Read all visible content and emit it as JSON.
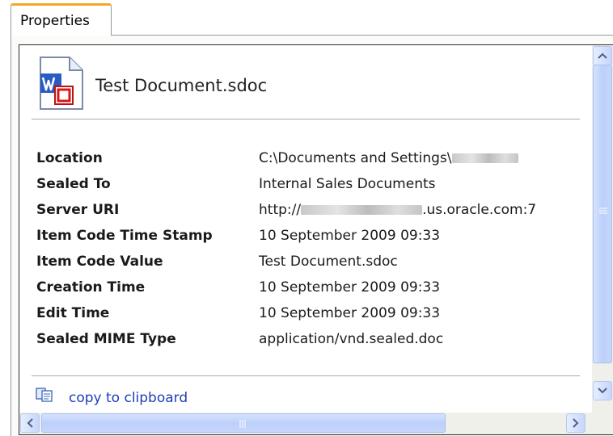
{
  "tab": {
    "label": "Properties"
  },
  "document": {
    "title": "Test Document.sdoc",
    "icon": "sealed-word-document-icon"
  },
  "properties": [
    {
      "label": "Location",
      "value": "C:\\Documents and Settings\\"
    },
    {
      "label": "Sealed To",
      "value": "Internal Sales Documents"
    },
    {
      "label": "Server URI",
      "value_prefix": "http://",
      "value_suffix": ".us.oracle.com:7"
    },
    {
      "label": "Item Code Time Stamp",
      "value": "10 September 2009 09:33"
    },
    {
      "label": "Item Code Value",
      "value": "Test Document.sdoc"
    },
    {
      "label": "Creation Time",
      "value": "10 September 2009 09:33"
    },
    {
      "label": "Edit Time",
      "value": "10 September 2009 09:33"
    },
    {
      "label": "Sealed MIME Type",
      "value": "application/vnd.sealed.doc"
    }
  ],
  "actions": {
    "copy_label": "copy to clipboard",
    "copy_icon": "copy-icon"
  },
  "colors": {
    "tab_accent": "#f5a623",
    "link": "#1c3fb8",
    "scrollbar": "#c6d6fb"
  }
}
